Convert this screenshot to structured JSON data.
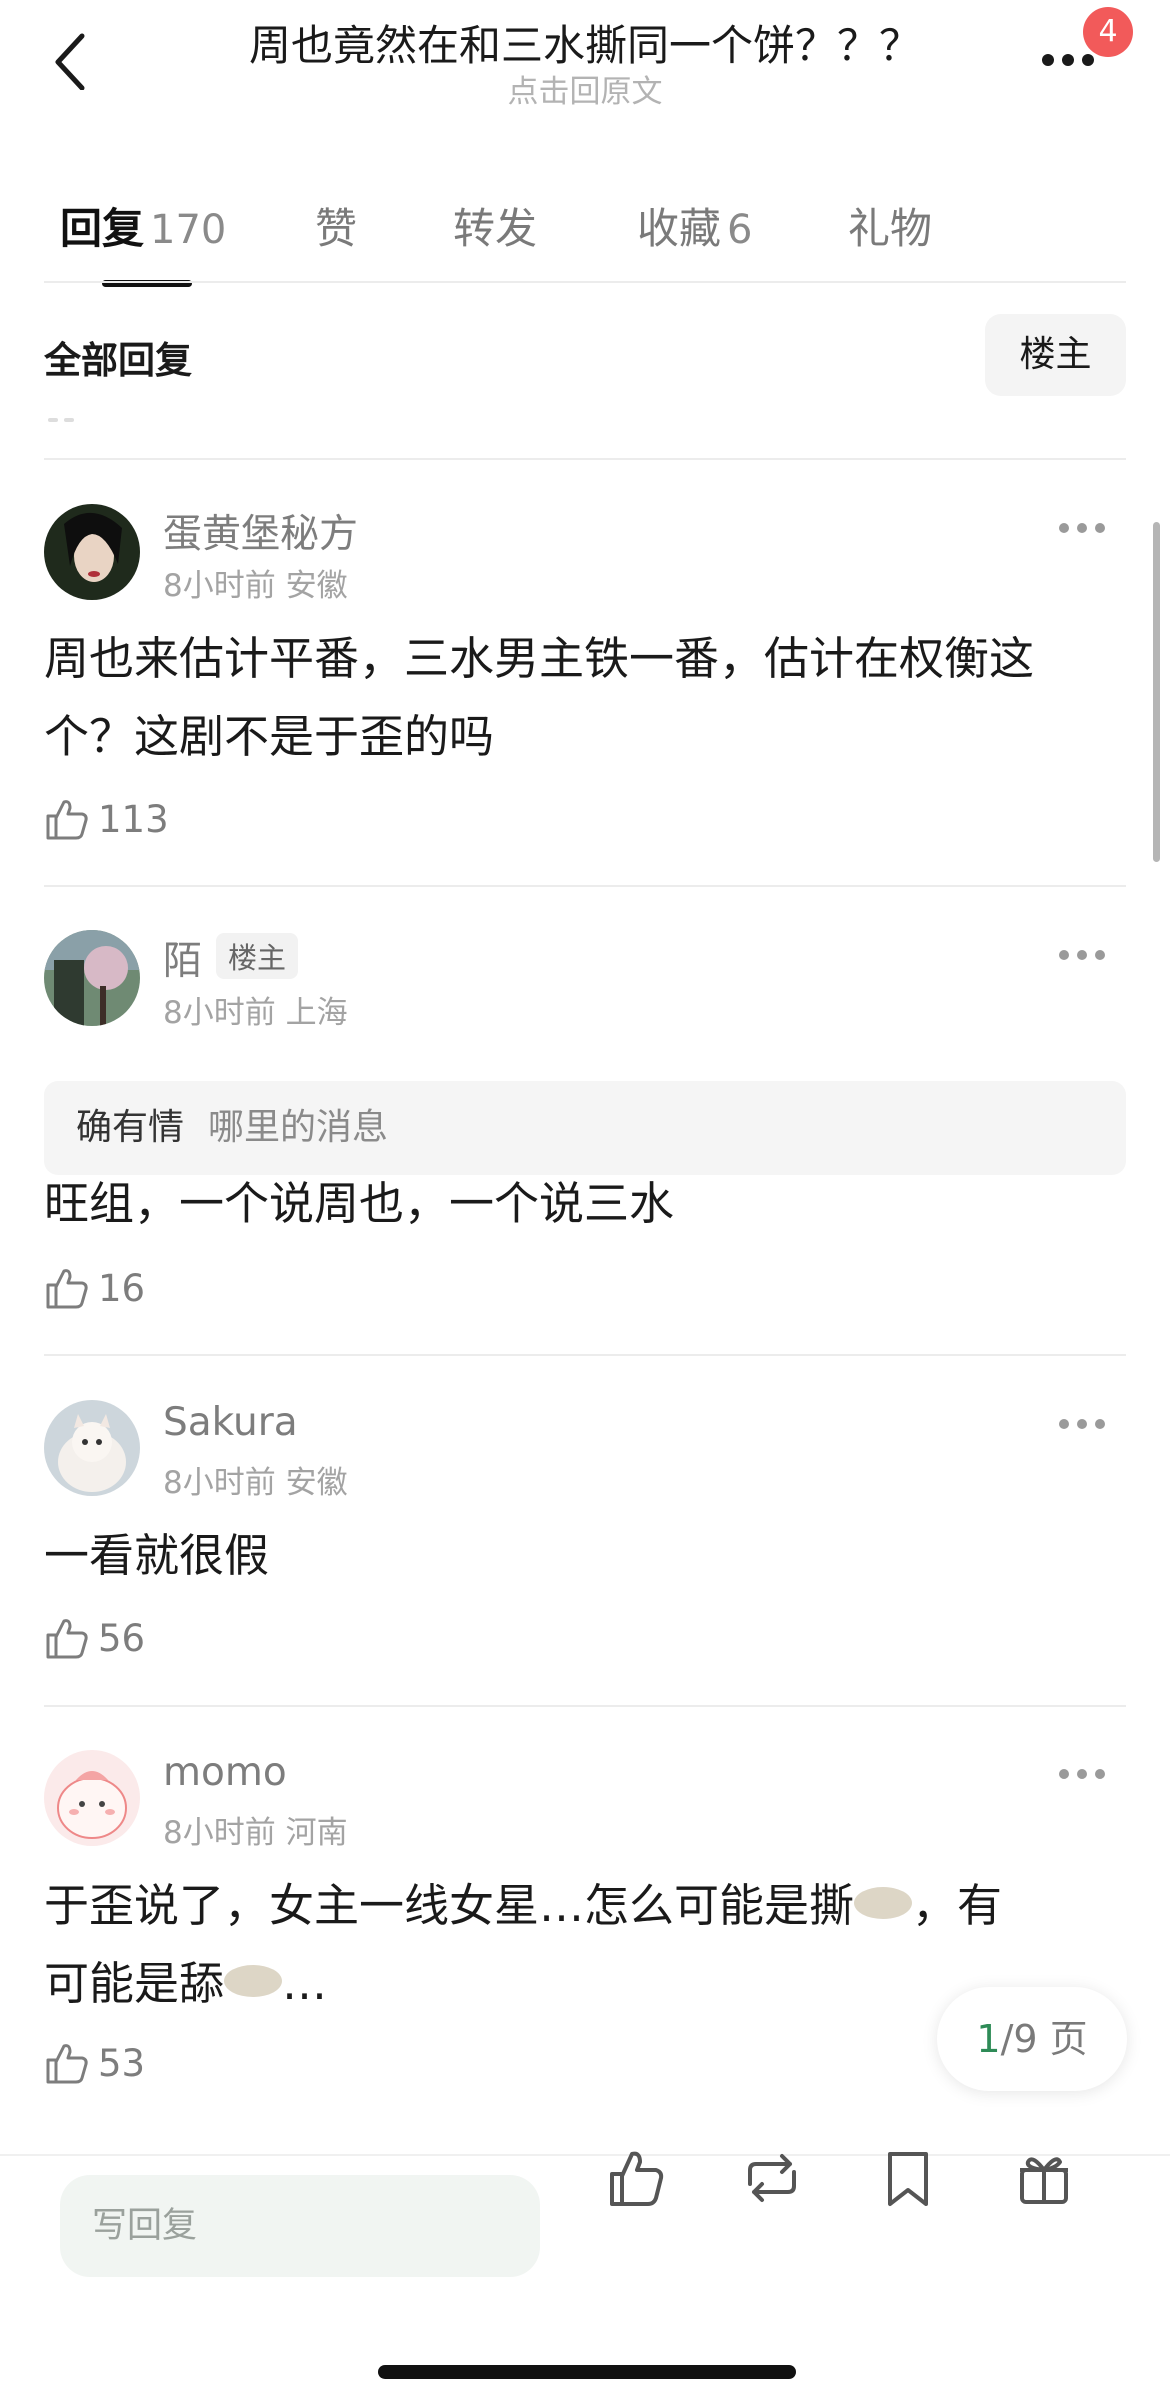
{
  "header": {
    "title": "周也竟然在和三水撕同一个饼？？？",
    "subtitle": "点击回原文",
    "notification_count": "4"
  },
  "tabs": [
    {
      "label": "回复",
      "count": "170"
    },
    {
      "label": "赞",
      "count": ""
    },
    {
      "label": "转发",
      "count": ""
    },
    {
      "label": "收藏",
      "count": "6"
    },
    {
      "label": "礼物",
      "count": ""
    }
  ],
  "filter": {
    "label": "全部回复",
    "button": "楼主"
  },
  "comments": [
    {
      "user": "蛋黄堡秘方",
      "time": "8小时前",
      "location": "安徽",
      "text_line1": "周也来估计平番，三水男主铁一番，估计在权衡这",
      "text_line2": "个？这剧不是于歪的吗",
      "likes": "113"
    },
    {
      "user": "陌",
      "badge": "楼主",
      "time": "8小时前",
      "location": "上海",
      "quote_name": "确有情",
      "quote_text": "哪里的消息",
      "text_line1": "旺组，一个说周也，一个说三水",
      "likes": "16"
    },
    {
      "user": "Sakura",
      "time": "8小时前",
      "location": "安徽",
      "text_line1": "一看就很假",
      "likes": "56"
    },
    {
      "user": "momo",
      "time": "8小时前",
      "location": "河南",
      "text_line1_a": "于歪说了，女主一线女星…怎么可能是撕",
      "text_line1_b": "，有",
      "text_line2_a": "可能是舔",
      "text_line2_b": "…",
      "likes": "53"
    }
  ],
  "pager": {
    "current": "1",
    "total_label": "/9 页"
  },
  "bottom": {
    "reply_placeholder": "写回复"
  },
  "colors": {
    "accent_green": "#2e8b57",
    "badge_red": "#f25a5a"
  }
}
